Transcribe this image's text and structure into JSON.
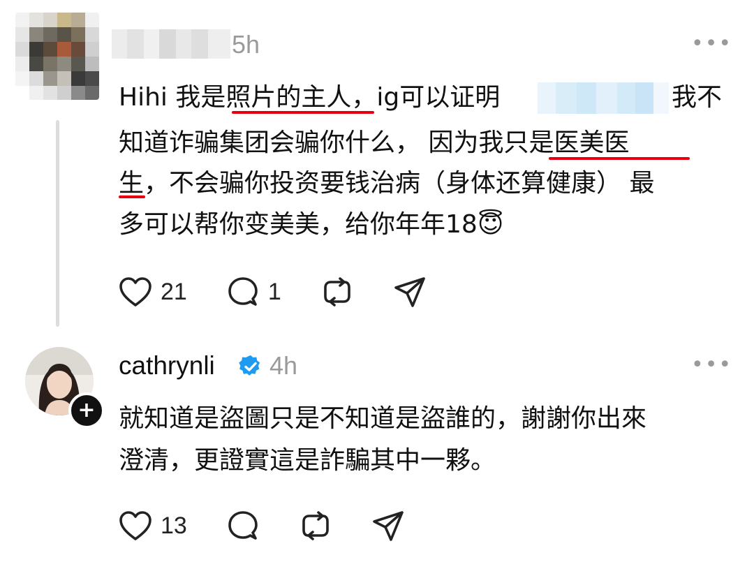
{
  "post1": {
    "author_name_redacted": "",
    "time": "5h",
    "more_label": "•••",
    "lines": [
      [
        "Hihi 我是",
        "照片的主人",
        "，ig可以证明"
      ],
      [
        "",
        "我不"
      ],
      [
        "知道诈骗集团会骗你什么， 因为我",
        "只是医美医"
      ],
      [
        "生",
        "，不会骗你投资要钱治病（身体还算健康） 最"
      ],
      [
        "多可以帮你变美美，给你年年18",
        "😇"
      ]
    ],
    "likes": "21",
    "replies": "1"
  },
  "post2": {
    "username": "cathrynli",
    "verified": true,
    "time": "4h",
    "more_label": "•••",
    "follow_symbol": "+",
    "lines": [
      "就知道是盜圖只是不知道是盜誰的，謝謝你出來",
      "澄清，更證實這是詐騙其中一夥。"
    ],
    "likes": "13"
  },
  "colors": {
    "underline": "#e60012",
    "verified": "#1d9bf0",
    "muted": "#9a9a9a"
  },
  "icons": [
    "heart-icon",
    "comment-icon",
    "repost-icon",
    "share-icon",
    "verified-badge-icon",
    "more-icon",
    "plus-icon"
  ]
}
